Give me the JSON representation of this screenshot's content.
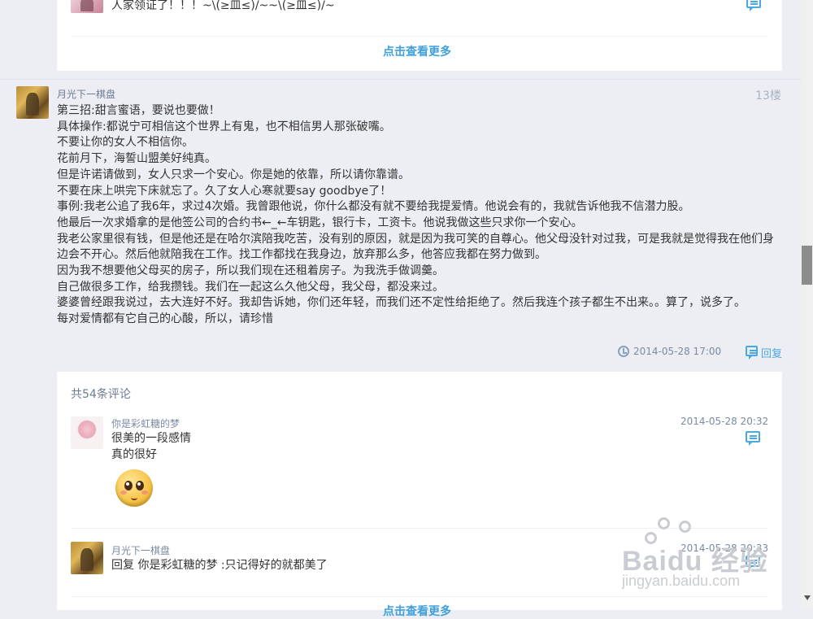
{
  "top_section": {
    "comment_text": "人家领证了！！！~\\(≥皿≤)/~~\\(≥皿≤)/~",
    "more_link": "点击查看更多"
  },
  "post": {
    "author": "月光下一棋盘",
    "floor": "13楼",
    "lines": [
      "第三招:甜言蜜语，要说也要做！",
      "具体操作:都说宁可相信这个世界上有鬼，也不相信男人那张破嘴。",
      "不要让你的女人不相信你。",
      "花前月下，海誓山盟美好纯真。",
      "但是许诺请做到，女人只求一个安心。你是她的依靠，所以请你靠谱。",
      "不要在床上哄完下床就忘了。久了女人心寒就要say goodbye了！",
      "事例:我老公追了我6年，求过4次婚。我曾跟他说，你什么都没有就不要给我提爱情。他说会有的，我就告诉他我不信潜力股。",
      "他最后一次求婚拿的是他签公司的合约书←_←车钥匙，银行卡，工资卡。他说我做这些只求你一个安心。",
      "我老公家里很有钱，但是他还是在哈尔滨陪我吃苦，没有别的原因，就是因为我可笑的自尊心。他父母没针对过我，可是我就是觉得我在他们身边会不开心。然后他就陪我在工作。找工作都找在我身边，放弃那么多，他答应我都在努力做到。",
      "因为我不想要他父母买的房子，所以我们现在还租着房子。为我洗手做调羹。",
      "自己做很多工作，给我攒钱。我们在一起这么久他父母，我父母，都没来过。",
      "婆婆曾经跟我说过，去大连好不好。我却告诉她，你们还年轻，而我们还不定性给拒绝了。然后我连个孩子都生不出来。。算了，说多了。",
      "每对爱情都有它自己的心酸，所以，请珍惜"
    ],
    "timestamp": "2014-05-28 17:00",
    "reply_label": "回复"
  },
  "comments": {
    "count_label": "共54条评论",
    "items": [
      {
        "author": "你是彩虹糖的梦",
        "text_line1": "很美的一段感情",
        "text_line2": "真的很好",
        "date": "2014-05-28 20:32"
      },
      {
        "author": "月光下一棋盘",
        "text": "回复 你是彩虹糖的梦 :只记得好的就都美了",
        "date": "2014-05-28 20:33"
      }
    ],
    "more_link": "点击查看更多"
  },
  "watermark": {
    "brand": "Baidu 经验",
    "url": "jingyan.baidu.com"
  }
}
